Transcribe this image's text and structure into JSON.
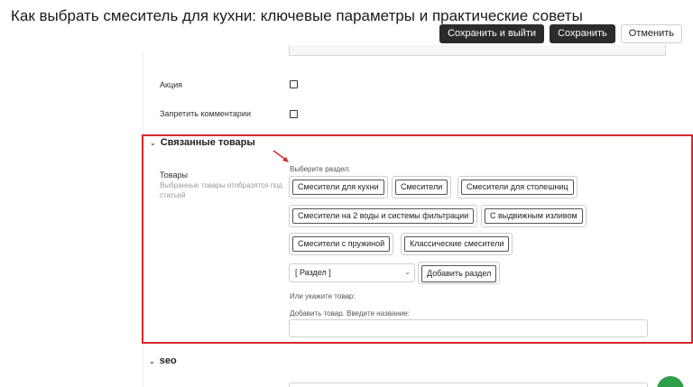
{
  "header": {
    "title": "Как выбрать смеситель для кухни: ключевые параметры и практические советы",
    "save_exit_label": "Сохранить и выйти",
    "save_label": "Сохранить",
    "cancel_label": "Отменить"
  },
  "fields": {
    "promo_label": "Акция",
    "promo_checked": false,
    "disable_comments_label": "Запретить комментарии",
    "disable_comments_checked": false
  },
  "related": {
    "section_title": "Связанные товары",
    "products_label": "Товары",
    "products_hint": "Выбранные товары отобразятся под статьей",
    "choose_section_label": "Выберите раздел:",
    "chips": [
      "Смесители для кухни",
      "Смесители",
      "Смесители для столешниц",
      "Смесители на 2 воды и системы фильтрации",
      "С выдвижным изливом",
      "Смесители с пружиной",
      "Классические смесители"
    ],
    "select_value": "[ Раздел ]",
    "add_section_label": "Добавить раздел",
    "or_product_label": "Или укажите товар:",
    "add_product_label": "Добавить товар. Введите название:",
    "add_product_value": ""
  },
  "seo": {
    "section_title": "seo"
  },
  "icons": {
    "chevron": "chevron-down-icon",
    "annotation_arrow": "red-arrow-icon"
  },
  "colors": {
    "highlight": "#d9262c",
    "primary_button": "#2b2b2b",
    "fab": "#2e9e4a"
  }
}
